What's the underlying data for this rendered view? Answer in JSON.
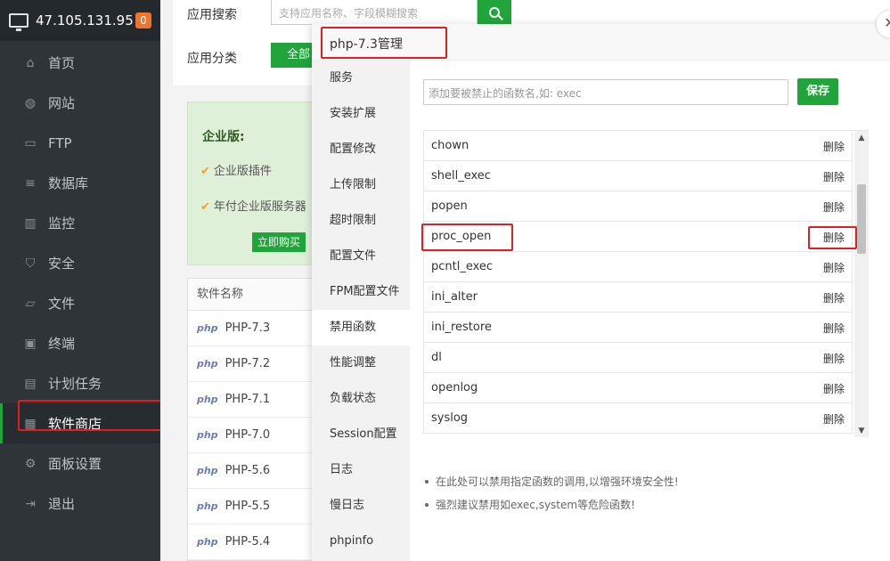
{
  "sidebar": {
    "ip": "47.105.131.95",
    "badge": "0",
    "items": [
      {
        "label": "首页",
        "icon": "home-icon",
        "glyph": "⌂"
      },
      {
        "label": "网站",
        "icon": "globe-icon",
        "glyph": "◍"
      },
      {
        "label": "FTP",
        "icon": "ftp-icon",
        "glyph": "▭"
      },
      {
        "label": "数据库",
        "icon": "database-icon",
        "glyph": "≡"
      },
      {
        "label": "监控",
        "icon": "monitor-chart-icon",
        "glyph": "▥"
      },
      {
        "label": "安全",
        "icon": "shield-icon",
        "glyph": "⛉"
      },
      {
        "label": "文件",
        "icon": "folder-icon",
        "glyph": "▱"
      },
      {
        "label": "终端",
        "icon": "terminal-icon",
        "glyph": "▣"
      },
      {
        "label": "计划任务",
        "icon": "calendar-icon",
        "glyph": "▤"
      },
      {
        "label": "软件商店",
        "icon": "apps-icon",
        "glyph": "▦"
      },
      {
        "label": "面板设置",
        "icon": "gear-icon",
        "glyph": "⚙"
      },
      {
        "label": "退出",
        "icon": "logout-icon",
        "glyph": "⇥"
      }
    ]
  },
  "main": {
    "search_label": "应用搜索",
    "search_placeholder": "支持应用名称、字段模糊搜索",
    "category_label": "应用分类",
    "category_all": "全部",
    "enterprise": {
      "title": "企业版:",
      "item1": "企业版插件",
      "item2": "年付企业版服务器",
      "buy": "立即购买"
    },
    "software_table": {
      "header": "软件名称",
      "rows": [
        "PHP-7.3",
        "PHP-7.2",
        "PHP-7.1",
        "PHP-7.0",
        "PHP-5.6",
        "PHP-5.5",
        "PHP-5.4"
      ]
    }
  },
  "modal": {
    "title": "php-7.3管理",
    "tabs": [
      "服务",
      "安装扩展",
      "配置修改",
      "上传限制",
      "超时限制",
      "配置文件",
      "FPM配置文件",
      "禁用函数",
      "性能调整",
      "负载状态",
      "Session配置",
      "日志",
      "慢日志",
      "phpinfo"
    ],
    "input_placeholder": "添加要被禁止的函数名,如: exec",
    "save_label": "保存",
    "delete_label": "删除",
    "functions": [
      "chown",
      "shell_exec",
      "popen",
      "proc_open",
      "pcntl_exec",
      "ini_alter",
      "ini_restore",
      "dl",
      "openlog",
      "syslog"
    ],
    "tips": [
      "在此处可以禁用指定函数的调用,以增强环境安全性!",
      "强烈建议禁用如exec,system等危险函数!"
    ]
  },
  "colors": {
    "accent": "#20a53a",
    "sidebar_bg": "#2e3438",
    "highlight_red": "#e02020",
    "badge_orange": "#f0732e"
  }
}
